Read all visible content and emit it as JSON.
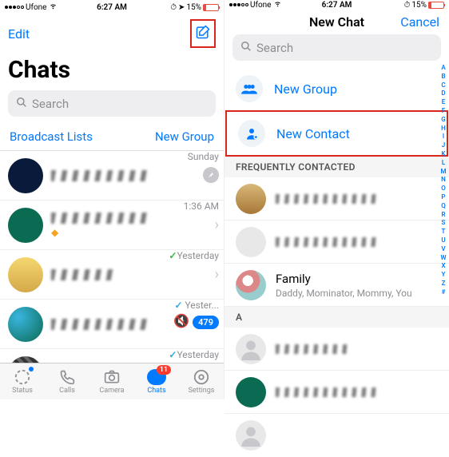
{
  "status_bar": {
    "carrier": "Ufone",
    "time": "6:27 AM",
    "battery_pct": "15%"
  },
  "left": {
    "edit": "Edit",
    "title": "Chats",
    "search_placeholder": "Search",
    "broadcast": "Broadcast Lists",
    "new_group": "New Group",
    "chats": [
      {
        "time": "Sunday",
        "pinned": true
      },
      {
        "time": "1:36 AM"
      },
      {
        "time": "Yesterday",
        "check": "green"
      },
      {
        "time": "Yester...",
        "check": "blue",
        "muted": true,
        "badge": "479"
      },
      {
        "time": "Yesterday",
        "check": "blue"
      }
    ],
    "tabs": {
      "status": "Status",
      "calls": "Calls",
      "camera": "Camera",
      "chats": "Chats",
      "chats_badge": "11",
      "settings": "Settings"
    }
  },
  "right": {
    "title": "New Chat",
    "cancel": "Cancel",
    "search_placeholder": "Search",
    "new_group": "New Group",
    "new_contact": "New Contact",
    "freq_header": "FREQUENTLY CONTACTED",
    "family": {
      "name": "Family",
      "members": "Daddy, Mominator, Mommy, You"
    },
    "section_a": "A",
    "index": [
      "A",
      "B",
      "C",
      "D",
      "E",
      "F",
      "G",
      "H",
      "I",
      "J",
      "K",
      "L",
      "M",
      "N",
      "O",
      "P",
      "Q",
      "R",
      "S",
      "T",
      "U",
      "V",
      "W",
      "X",
      "Y",
      "Z",
      "#"
    ]
  }
}
